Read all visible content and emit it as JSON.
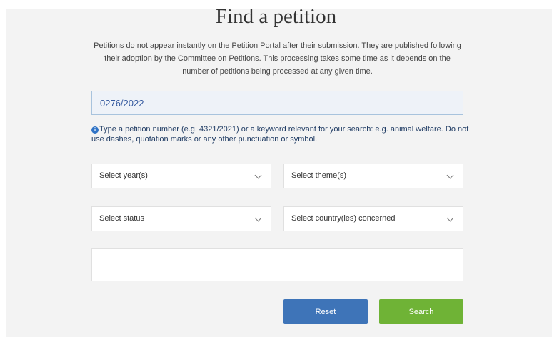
{
  "page": {
    "title": "Find a petition",
    "intro": "Petitions do not appear instantly on the Petition Portal after their submission. They are published following their adoption by the Committee on Petitions. This processing takes some time as it depends on the number of petitions being processed at any given time."
  },
  "search": {
    "value": "0276/2022",
    "hint_icon": "info-icon",
    "hint": "Type a petition number (e.g. 4321/2021) or a keyword relevant for your search: e.g. animal welfare. Do not use dashes, quotation marks or any other punctuation or symbol."
  },
  "filters": {
    "year": "Select year(s)",
    "theme": "Select theme(s)",
    "status": "Select status",
    "country": "Select country(ies) concerned"
  },
  "buttons": {
    "reset": "Reset",
    "search": "Search"
  },
  "colors": {
    "reset_button": "#3e74b8",
    "search_button": "#6fb336",
    "info_icon": "#2f73c6"
  }
}
